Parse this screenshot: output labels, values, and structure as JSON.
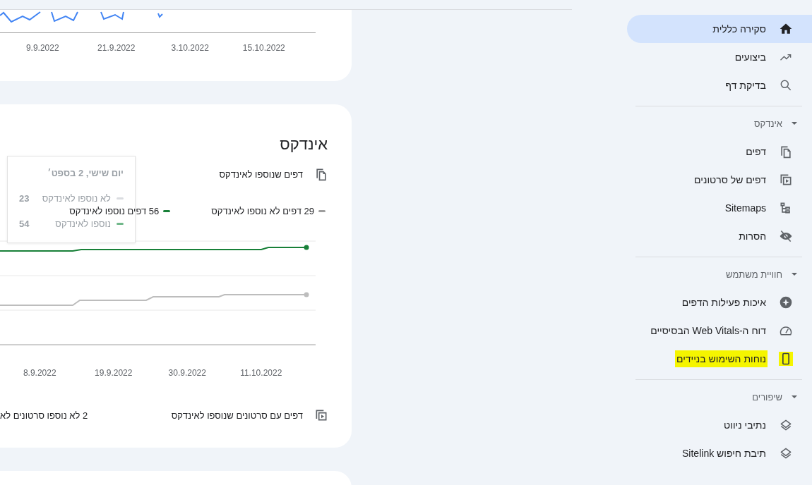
{
  "overview_card": {
    "x_labels": [
      "15.10.2022",
      "3.10.2022",
      "21.9.2022",
      "9.9.2022"
    ]
  },
  "index_card": {
    "title": "אינדקס",
    "pages_row": {
      "label": "דפים שנוספו לאינדקס"
    },
    "legend": [
      {
        "label": "29 דפים לא נוספו לאינדקס",
        "color": "#9e9e9e"
      },
      {
        "label": "56 דפים נוספו לאינדקס",
        "color": "#188038"
      }
    ],
    "tooltip": {
      "title": "יום שישי, 2 בספט׳",
      "rows": [
        {
          "label": "לא נוספו לאינדקס",
          "value": "23",
          "color": "#dadce0"
        },
        {
          "label": "נוספו לאינדקס",
          "value": "54",
          "color": "#71b88a"
        }
      ]
    },
    "x_labels": [
      "11.10.2022",
      "30.9.2022",
      "19.9.2022",
      "8.9.2022"
    ],
    "video_row": {
      "label": "דפים עם סרטונים שנוספו לאינדקס",
      "summary": "2 לא נוספו סרטונים לא"
    }
  },
  "sidebar": {
    "items": [
      {
        "label": "סקירה כללית",
        "selected": true,
        "highlighted": false
      },
      {
        "label": "ביצועים",
        "selected": false,
        "highlighted": false
      },
      {
        "label": "בדיקת דף",
        "selected": false,
        "highlighted": false
      }
    ],
    "sections": [
      {
        "title": "אינדקס",
        "expanded": true,
        "items": [
          {
            "label": "דפים",
            "selected": false,
            "highlighted": false
          },
          {
            "label": "דפים של סרטונים",
            "selected": false,
            "highlighted": false
          },
          {
            "label": "Sitemaps",
            "selected": false,
            "highlighted": false
          },
          {
            "label": "הסרות",
            "selected": false,
            "highlighted": false
          }
        ]
      },
      {
        "title": "חוויית משתמש",
        "expanded": true,
        "items": [
          {
            "label": "איכות פעילות הדפים",
            "selected": false,
            "highlighted": false
          },
          {
            "label": "דוח ה-Web Vitals הבסיסיים",
            "selected": false,
            "highlighted": false
          },
          {
            "label": "נוחות השימוש בניידים",
            "selected": false,
            "highlighted": true
          }
        ]
      },
      {
        "title": "שיפורים",
        "expanded": true,
        "items": [
          {
            "label": "נתיבי ניווט",
            "selected": false,
            "highlighted": false
          },
          {
            "label": "תיבת חיפוש Sitelink",
            "selected": false,
            "highlighted": false
          }
        ]
      }
    ]
  }
}
